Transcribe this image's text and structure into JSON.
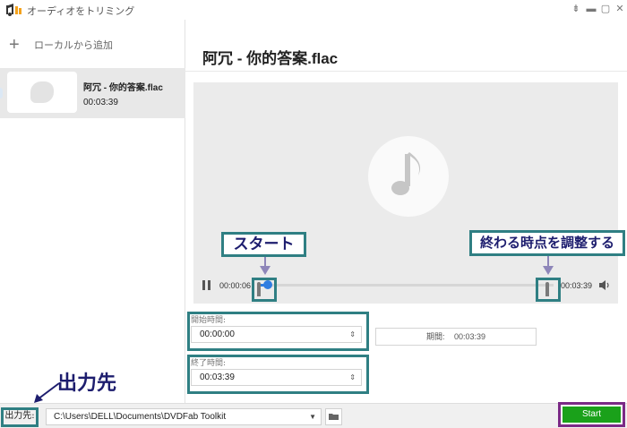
{
  "window": {
    "title": "オーディオをトリミング",
    "controls": [
      "pin-icon",
      "minimize-icon",
      "maximize-icon",
      "close-icon"
    ]
  },
  "sidebar": {
    "add_local_label": "ローカルから追加",
    "files": [
      {
        "name": "阿冗 - 你的答案.flac",
        "duration": "00:03:39"
      }
    ]
  },
  "main": {
    "title": "阿冗 - 你的答案.flac",
    "player": {
      "current_time": "00:00:06",
      "total_time": "00:03:39",
      "progress_fraction": 0.03
    },
    "start_field": {
      "label": "開始時間:",
      "value": "00:00:00"
    },
    "end_field": {
      "label": "終了時間:",
      "value": "00:03:39"
    },
    "duration": {
      "label": "期間:",
      "value": "00:03:39"
    }
  },
  "bottom": {
    "output_label": "出力先:",
    "output_path": "C:\\Users\\DELL\\Documents\\DVDFab Toolkit",
    "start_button": "Start"
  },
  "annotations": {
    "start_callout": "スタート",
    "end_callout": "終わる時点を調整する",
    "output_callout": "出力先"
  },
  "colors": {
    "accent": "#2f7de1",
    "start_button": "#1aa11a",
    "annotation_border": "#2f7f83",
    "start_highlight": "#7b2a86",
    "annotation_text": "#1d1d6e"
  }
}
